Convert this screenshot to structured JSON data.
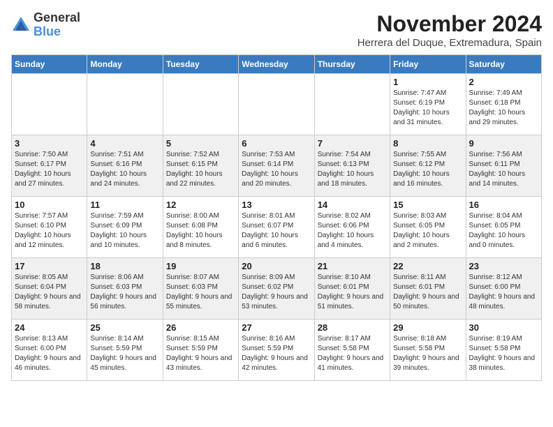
{
  "logo": {
    "general": "General",
    "blue": "Blue"
  },
  "title": "November 2024",
  "subtitle": "Herrera del Duque, Extremadura, Spain",
  "weekdays": [
    "Sunday",
    "Monday",
    "Tuesday",
    "Wednesday",
    "Thursday",
    "Friday",
    "Saturday"
  ],
  "weeks": [
    [
      {
        "day": "",
        "info": ""
      },
      {
        "day": "",
        "info": ""
      },
      {
        "day": "",
        "info": ""
      },
      {
        "day": "",
        "info": ""
      },
      {
        "day": "",
        "info": ""
      },
      {
        "day": "1",
        "info": "Sunrise: 7:47 AM\nSunset: 6:19 PM\nDaylight: 10 hours and 31 minutes."
      },
      {
        "day": "2",
        "info": "Sunrise: 7:49 AM\nSunset: 6:18 PM\nDaylight: 10 hours and 29 minutes."
      }
    ],
    [
      {
        "day": "3",
        "info": "Sunrise: 7:50 AM\nSunset: 6:17 PM\nDaylight: 10 hours and 27 minutes."
      },
      {
        "day": "4",
        "info": "Sunrise: 7:51 AM\nSunset: 6:16 PM\nDaylight: 10 hours and 24 minutes."
      },
      {
        "day": "5",
        "info": "Sunrise: 7:52 AM\nSunset: 6:15 PM\nDaylight: 10 hours and 22 minutes."
      },
      {
        "day": "6",
        "info": "Sunrise: 7:53 AM\nSunset: 6:14 PM\nDaylight: 10 hours and 20 minutes."
      },
      {
        "day": "7",
        "info": "Sunrise: 7:54 AM\nSunset: 6:13 PM\nDaylight: 10 hours and 18 minutes."
      },
      {
        "day": "8",
        "info": "Sunrise: 7:55 AM\nSunset: 6:12 PM\nDaylight: 10 hours and 16 minutes."
      },
      {
        "day": "9",
        "info": "Sunrise: 7:56 AM\nSunset: 6:11 PM\nDaylight: 10 hours and 14 minutes."
      }
    ],
    [
      {
        "day": "10",
        "info": "Sunrise: 7:57 AM\nSunset: 6:10 PM\nDaylight: 10 hours and 12 minutes."
      },
      {
        "day": "11",
        "info": "Sunrise: 7:59 AM\nSunset: 6:09 PM\nDaylight: 10 hours and 10 minutes."
      },
      {
        "day": "12",
        "info": "Sunrise: 8:00 AM\nSunset: 6:08 PM\nDaylight: 10 hours and 8 minutes."
      },
      {
        "day": "13",
        "info": "Sunrise: 8:01 AM\nSunset: 6:07 PM\nDaylight: 10 hours and 6 minutes."
      },
      {
        "day": "14",
        "info": "Sunrise: 8:02 AM\nSunset: 6:06 PM\nDaylight: 10 hours and 4 minutes."
      },
      {
        "day": "15",
        "info": "Sunrise: 8:03 AM\nSunset: 6:05 PM\nDaylight: 10 hours and 2 minutes."
      },
      {
        "day": "16",
        "info": "Sunrise: 8:04 AM\nSunset: 6:05 PM\nDaylight: 10 hours and 0 minutes."
      }
    ],
    [
      {
        "day": "17",
        "info": "Sunrise: 8:05 AM\nSunset: 6:04 PM\nDaylight: 9 hours and 58 minutes."
      },
      {
        "day": "18",
        "info": "Sunrise: 8:06 AM\nSunset: 6:03 PM\nDaylight: 9 hours and 56 minutes."
      },
      {
        "day": "19",
        "info": "Sunrise: 8:07 AM\nSunset: 6:03 PM\nDaylight: 9 hours and 55 minutes."
      },
      {
        "day": "20",
        "info": "Sunrise: 8:09 AM\nSunset: 6:02 PM\nDaylight: 9 hours and 53 minutes."
      },
      {
        "day": "21",
        "info": "Sunrise: 8:10 AM\nSunset: 6:01 PM\nDaylight: 9 hours and 51 minutes."
      },
      {
        "day": "22",
        "info": "Sunrise: 8:11 AM\nSunset: 6:01 PM\nDaylight: 9 hours and 50 minutes."
      },
      {
        "day": "23",
        "info": "Sunrise: 8:12 AM\nSunset: 6:00 PM\nDaylight: 9 hours and 48 minutes."
      }
    ],
    [
      {
        "day": "24",
        "info": "Sunrise: 8:13 AM\nSunset: 6:00 PM\nDaylight: 9 hours and 46 minutes."
      },
      {
        "day": "25",
        "info": "Sunrise: 8:14 AM\nSunset: 5:59 PM\nDaylight: 9 hours and 45 minutes."
      },
      {
        "day": "26",
        "info": "Sunrise: 8:15 AM\nSunset: 5:59 PM\nDaylight: 9 hours and 43 minutes."
      },
      {
        "day": "27",
        "info": "Sunrise: 8:16 AM\nSunset: 5:59 PM\nDaylight: 9 hours and 42 minutes."
      },
      {
        "day": "28",
        "info": "Sunrise: 8:17 AM\nSunset: 5:58 PM\nDaylight: 9 hours and 41 minutes."
      },
      {
        "day": "29",
        "info": "Sunrise: 8:18 AM\nSunset: 5:58 PM\nDaylight: 9 hours and 39 minutes."
      },
      {
        "day": "30",
        "info": "Sunrise: 8:19 AM\nSunset: 5:58 PM\nDaylight: 9 hours and 38 minutes."
      }
    ]
  ],
  "grayRows": [
    1,
    3
  ]
}
